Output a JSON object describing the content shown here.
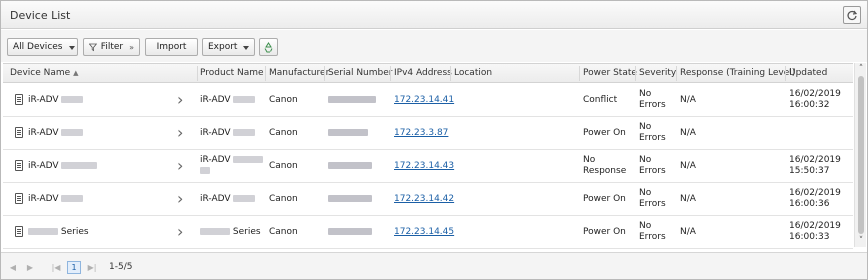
{
  "window": {
    "title": "Device List"
  },
  "toolbar": {
    "filter_select": "All Devices",
    "filter_label": "Filter",
    "import_label": "Import",
    "export_label": "Export"
  },
  "columns": [
    "Device Name",
    "Product Name",
    "Manufacturer",
    "Serial Number",
    "IPv4 Address",
    "Location",
    "Power State",
    "Severity",
    "Response (Training Level)",
    "Updated"
  ],
  "rows": [
    {
      "device_name": "iR-ADV",
      "product_name": "iR-ADV",
      "manufacturer": "Canon",
      "ip": "172.23.14.41",
      "power": "Conflict",
      "severity": "No Errors",
      "response": "N/A",
      "updated_date": "16/02/2019",
      "updated_time": "16:00:32"
    },
    {
      "device_name": "iR-ADV",
      "product_name": "iR-ADV",
      "manufacturer": "Canon",
      "ip": "172.23.3.87",
      "power": "Power On",
      "severity": "No Errors",
      "response": "N/A",
      "updated_date": "",
      "updated_time": ""
    },
    {
      "device_name": "iR-ADV",
      "product_name": "iR-ADV",
      "manufacturer": "Canon",
      "ip": "172.23.14.43",
      "power": "No Response",
      "severity": "No Errors",
      "response": "N/A",
      "updated_date": "16/02/2019",
      "updated_time": "15:50:37"
    },
    {
      "device_name": "iR-ADV",
      "product_name": "iR-ADV",
      "manufacturer": "Canon",
      "ip": "172.23.14.42",
      "power": "Power On",
      "severity": "No Errors",
      "response": "N/A",
      "updated_date": "16/02/2019",
      "updated_time": "16:00:36"
    },
    {
      "device_name": "Series",
      "product_name": "Series",
      "manufacturer": "Canon",
      "ip": "172.23.14.45",
      "power": "Power On",
      "severity": "No Errors",
      "response": "N/A",
      "updated_date": "16/02/2019",
      "updated_time": "16:00:33"
    }
  ],
  "pager": {
    "current_page": "1",
    "range": "1-5/5"
  },
  "icons": [
    "refresh-icon",
    "funnel-icon",
    "recycle-icon",
    "device-icon",
    "chevron-right-icon",
    "sort-asc-icon",
    "first-page-icon",
    "prev-page-icon",
    "next-page-icon",
    "last-page-icon"
  ],
  "colors": {
    "link": "#1b5fa6",
    "header_bg": "#ececec",
    "page_highlight": "#e3eefb"
  }
}
